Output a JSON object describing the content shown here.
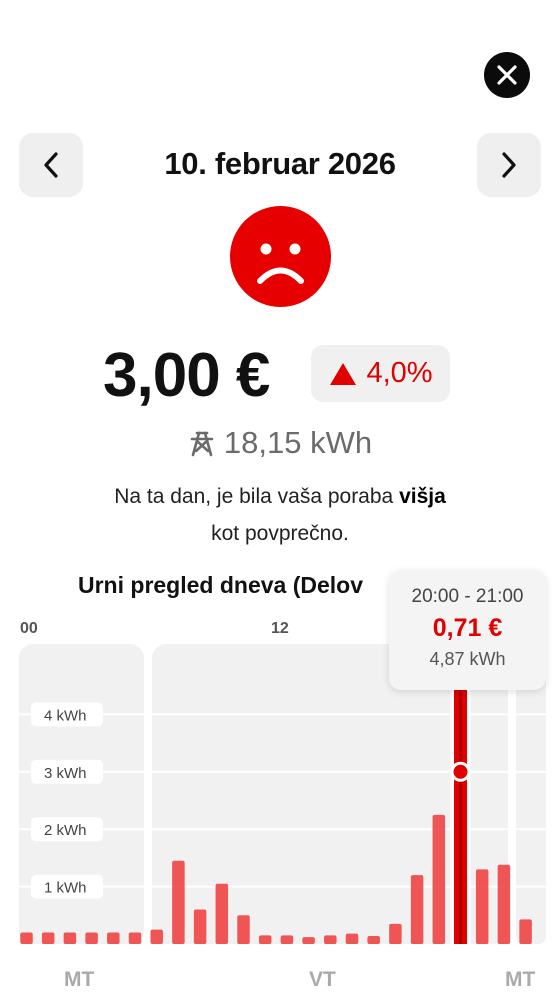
{
  "date_title": "10. februar 2026",
  "price": "3,00 €",
  "change": "4,0%",
  "energy": "18,15 kWh",
  "description": {
    "prefix": "Na ta dan, je bila vaša poraba ",
    "highlight": "višja",
    "suffix": " kot povprečno."
  },
  "chart_title": "Urni pregled dneva (Delov",
  "colors": {
    "accent": "#e60000",
    "badge_bg": "#f0f0f0",
    "bar": "#ef4444"
  },
  "icons": {
    "close": "close-icon",
    "prev": "chevron-left-icon",
    "next": "chevron-right-icon",
    "mood": "sad-face-icon",
    "energy": "power-pylon-icon",
    "up": "triangle-up-icon"
  },
  "tooltip": {
    "time": "20:00 - 21:00",
    "price": "0,71 €",
    "kwh": "4,87 kWh"
  },
  "chart_data": {
    "type": "bar",
    "hour_labels": [
      "00",
      "12"
    ],
    "day_labels": [
      "MT",
      "VT",
      "MT"
    ],
    "yticks": [
      "1 kWh",
      "2 kWh",
      "3 kWh",
      "4 kWh"
    ],
    "ylim": [
      0,
      5.0
    ],
    "values": [
      0.2,
      0.2,
      0.2,
      0.2,
      0.2,
      0.2,
      0.25,
      1.45,
      0.6,
      1.05,
      0.5,
      0.15,
      0.15,
      0.12,
      0.15,
      0.18,
      0.14,
      0.35,
      1.2,
      2.25,
      4.87,
      1.3,
      1.38,
      0.43
    ],
    "selected_index": 20,
    "grid": true
  }
}
